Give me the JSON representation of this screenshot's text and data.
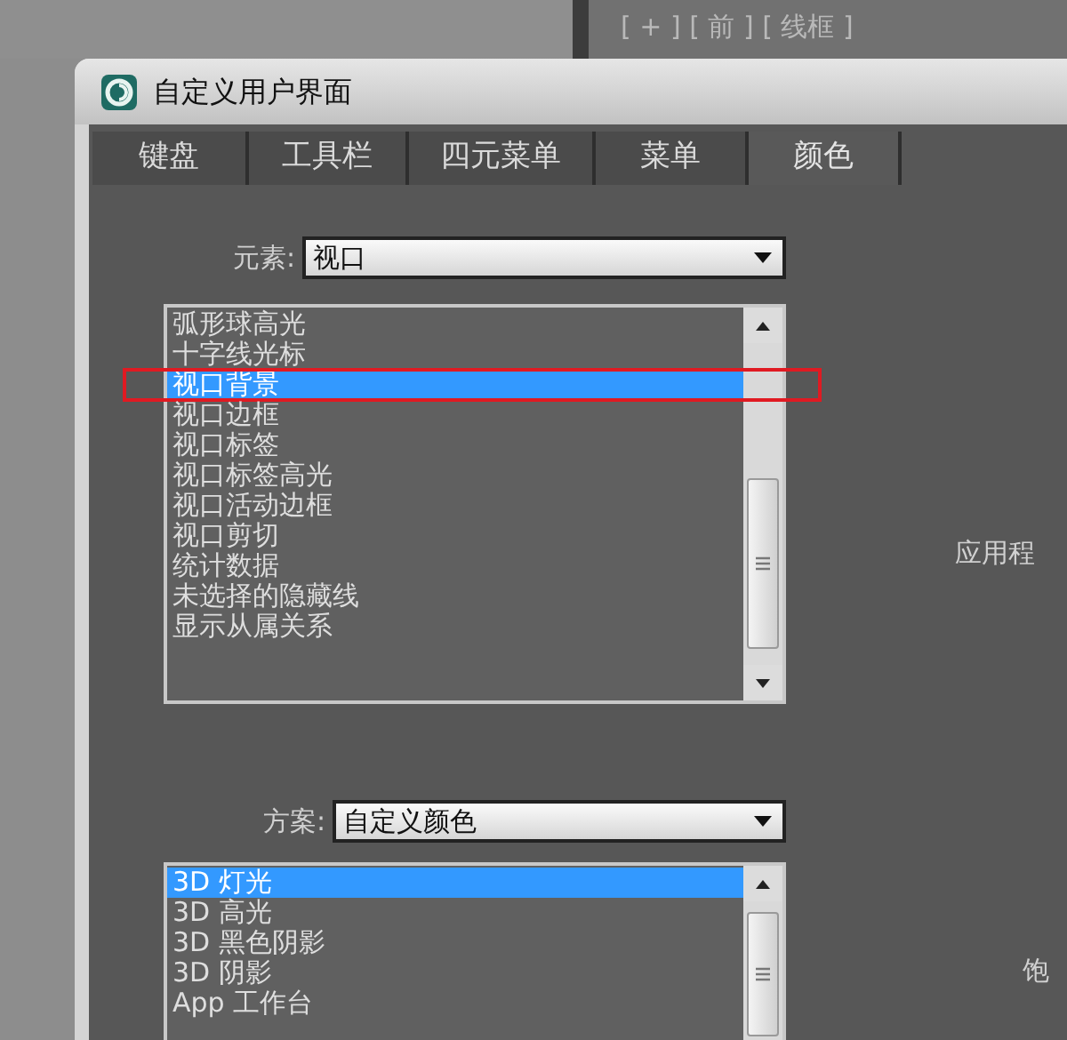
{
  "viewport_label": "[ + ] [ 前 ] [ 线框 ]",
  "window": {
    "title": "自定义用户界面"
  },
  "tabs": [
    {
      "label": "键盘",
      "selected": false
    },
    {
      "label": "工具栏",
      "selected": false
    },
    {
      "label": "四元菜单",
      "selected": false
    },
    {
      "label": "菜单",
      "selected": false
    },
    {
      "label": "颜色",
      "selected": true
    }
  ],
  "element": {
    "label": "元素:",
    "value": "视口",
    "side_label": "应用程",
    "items": [
      {
        "text": "弧形球高光",
        "selected": false,
        "outlined": false
      },
      {
        "text": "十字线光标",
        "selected": false,
        "outlined": false
      },
      {
        "text": "视口背景",
        "selected": true,
        "outlined": true
      },
      {
        "text": "视口边框",
        "selected": false,
        "outlined": false
      },
      {
        "text": "视口标签",
        "selected": false,
        "outlined": false
      },
      {
        "text": "视口标签高光",
        "selected": false,
        "outlined": false
      },
      {
        "text": "视口活动边框",
        "selected": false,
        "outlined": false
      },
      {
        "text": "视口剪切",
        "selected": false,
        "outlined": false
      },
      {
        "text": "统计数据",
        "selected": false,
        "outlined": false
      },
      {
        "text": "未选择的隐藏线",
        "selected": false,
        "outlined": false
      },
      {
        "text": "显示从属关系",
        "selected": false,
        "outlined": false
      }
    ]
  },
  "scheme": {
    "label": "方案:",
    "value": "自定义颜色",
    "side_label": "饱",
    "items": [
      {
        "text": "3D 灯光",
        "selected": true,
        "outlined": false
      },
      {
        "text": "3D 高光",
        "selected": false,
        "outlined": false
      },
      {
        "text": "3D 黑色阴影",
        "selected": false,
        "outlined": false
      },
      {
        "text": "3D 阴影",
        "selected": false,
        "outlined": false
      },
      {
        "text": "App 工作台",
        "selected": false,
        "outlined": false
      }
    ]
  }
}
